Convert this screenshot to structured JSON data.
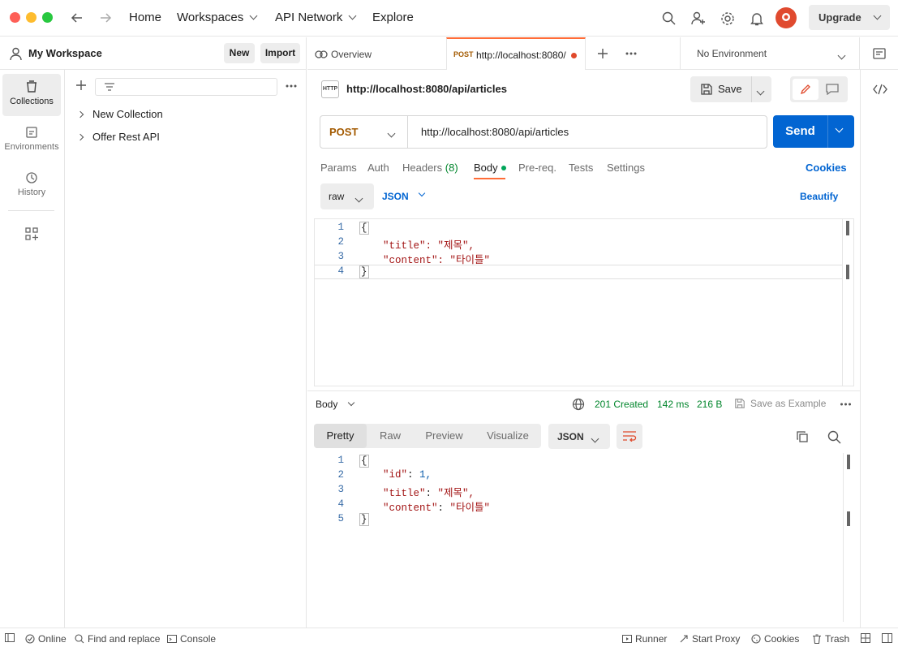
{
  "topbar": {
    "home": "Home",
    "workspaces": "Workspaces",
    "api_network": "API Network",
    "explore": "Explore",
    "upgrade": "Upgrade"
  },
  "workspace": {
    "name": "My Workspace",
    "new_label": "New",
    "import_label": "Import"
  },
  "rail": {
    "collections": "Collections",
    "environments": "Environments",
    "history": "History"
  },
  "collections": [
    "New Collection",
    "Offer Rest API"
  ],
  "tabs": {
    "overview": "Overview",
    "active_method": "POST",
    "active_url": "http://localhost:8080/",
    "environment": "No Environment"
  },
  "request": {
    "title": "http://localhost:8080/api/articles",
    "save_label": "Save",
    "method": "POST",
    "url": "http://localhost:8080/api/articles",
    "send_label": "Send",
    "subtabs": [
      "Params",
      "Auth",
      "Headers",
      "(8)",
      "Body",
      "Pre-req.",
      "Tests",
      "Settings"
    ],
    "cookies": "Cookies",
    "body_mode": "raw",
    "body_lang": "JSON",
    "beautify": "Beautify",
    "body_lines": [
      "{",
      "\"title\": \"제목\",",
      "\"content\": \"타이틀\"",
      "}"
    ],
    "line_numbers": [
      "1",
      "2",
      "3",
      "4"
    ]
  },
  "response": {
    "body_label": "Body",
    "status": "201 Created",
    "time": "142 ms",
    "size": "216 B",
    "save_example": "Save as Example",
    "views": [
      "Pretty",
      "Raw",
      "Preview",
      "Visualize"
    ],
    "format": "JSON",
    "line_numbers": [
      "1",
      "2",
      "3",
      "4",
      "5"
    ],
    "lines": [
      {
        "key": "",
        "sep": "",
        "val": "{"
      },
      {
        "key": "\"id\"",
        "sep": ": ",
        "val": "1,"
      },
      {
        "key": "\"title\"",
        "sep": ": ",
        "val": "\"제목\","
      },
      {
        "key": "\"content\"",
        "sep": ": ",
        "val": "\"타이틀\""
      },
      {
        "key": "",
        "sep": "",
        "val": "}"
      }
    ]
  },
  "statusbar": {
    "online": "Online",
    "find_replace": "Find and replace",
    "console": "Console",
    "runner": "Runner",
    "start_proxy": "Start Proxy",
    "cookies": "Cookies",
    "trash": "Trash"
  },
  "colors": {
    "accent": "#0265d2",
    "orange": "#ff6c37",
    "status_green": "#00852b",
    "method_orange": "#a35a00"
  }
}
